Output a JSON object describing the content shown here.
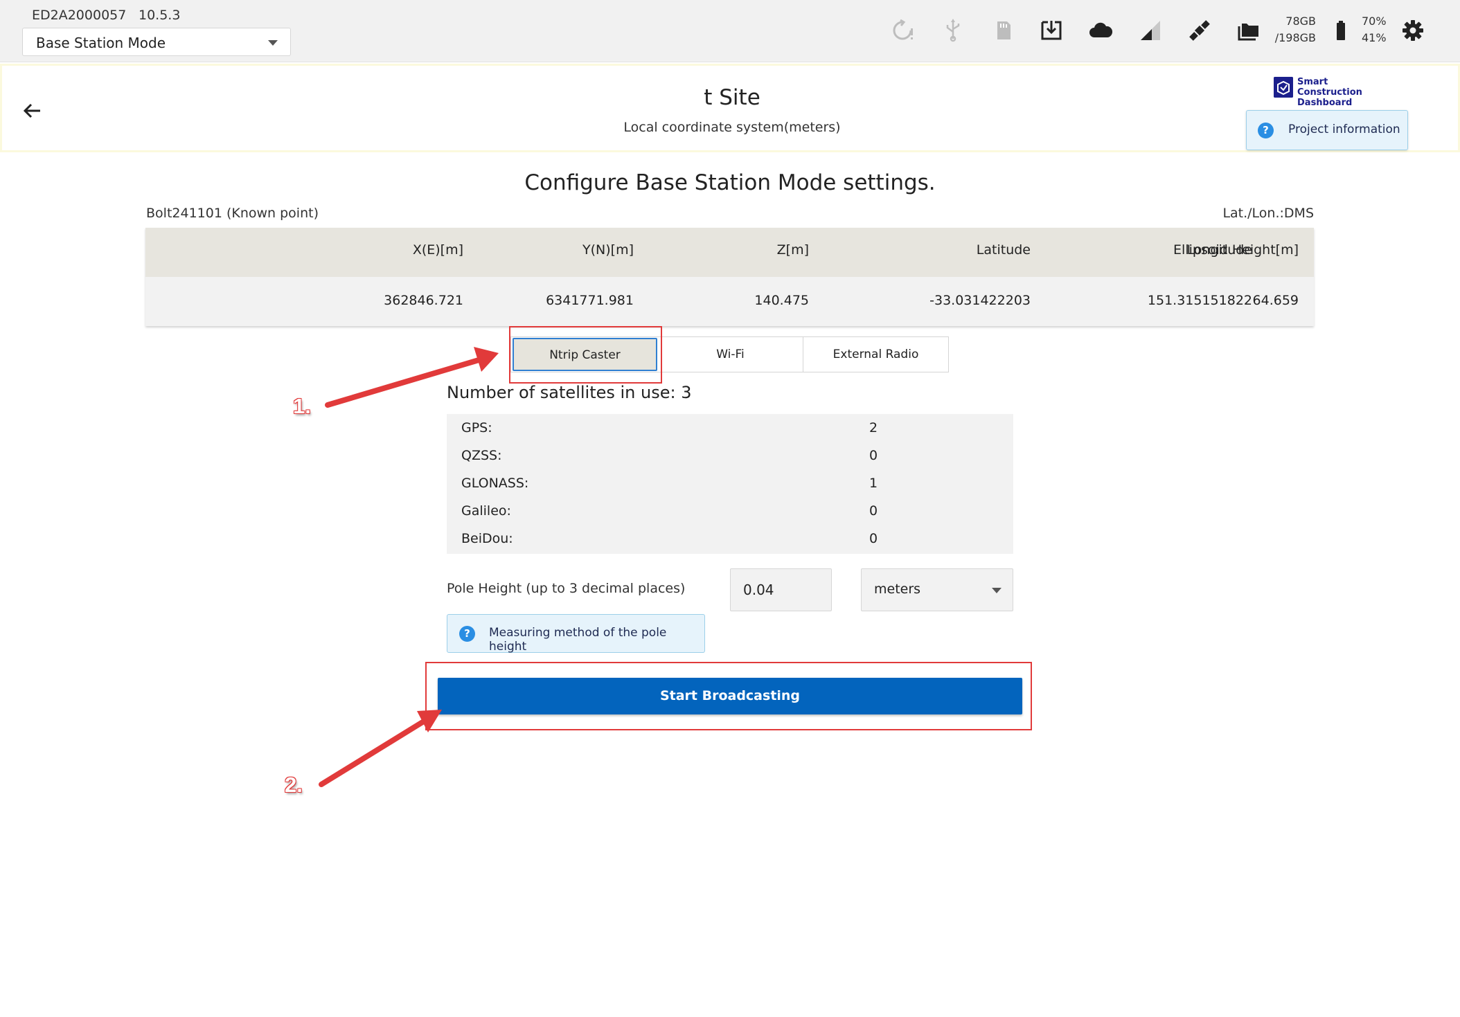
{
  "topbar": {
    "device_id": "ED2A2000057",
    "version": "10.5.3",
    "mode_value": "Base Station Mode",
    "storage_used": "78GB",
    "storage_total": "/198GB",
    "battery_1": "70%",
    "battery_2": "41%",
    "icons": [
      "reload-warning-icon",
      "usb-icon",
      "sd-card-icon",
      "download-icon",
      "cloud-icon",
      "signal-icon",
      "satellite-icon",
      "folder-icon",
      "battery-icon",
      "gear-icon"
    ]
  },
  "header": {
    "title": "t Site",
    "subtitle": "Local coordinate system(meters)",
    "logo_line1": "Smart Construction",
    "logo_line2": "Dashboard",
    "project_info_label": "Project information"
  },
  "main": {
    "title": "Configure Base Station Mode settings.",
    "point_name": "Bolt241101 (Known point)",
    "latlon_format": "Lat./Lon.:DMS",
    "table": {
      "headers": [
        "X(E)[m]",
        "Y(N)[m]",
        "Z[m]",
        "Latitude",
        "Longitude",
        "Ellipsoid Height[m]"
      ],
      "values": [
        "362846.721",
        "6341771.981",
        "140.475",
        "-33.031422203",
        "151.315151822",
        "64.659"
      ]
    },
    "tabs": [
      "Ntrip Caster",
      "Wi-Fi",
      "External Radio"
    ],
    "active_tab": "Ntrip Caster",
    "satellites_title": "Number of satellites in use: 3",
    "satellites": [
      {
        "name": "GPS:",
        "count": "2"
      },
      {
        "name": "QZSS:",
        "count": "0"
      },
      {
        "name": "GLONASS:",
        "count": "1"
      },
      {
        "name": "Galileo:",
        "count": "0"
      },
      {
        "name": "BeiDou:",
        "count": "0"
      }
    ],
    "pole_label": "Pole Height (up to 3 decimal places)",
    "pole_value": "0.04",
    "unit_value": "meters",
    "measure_label": "Measuring method of the pole height",
    "start_label": "Start Broadcasting"
  },
  "annotations": {
    "step1": "1.",
    "step2": "2.",
    "color": "#e13a3a"
  }
}
